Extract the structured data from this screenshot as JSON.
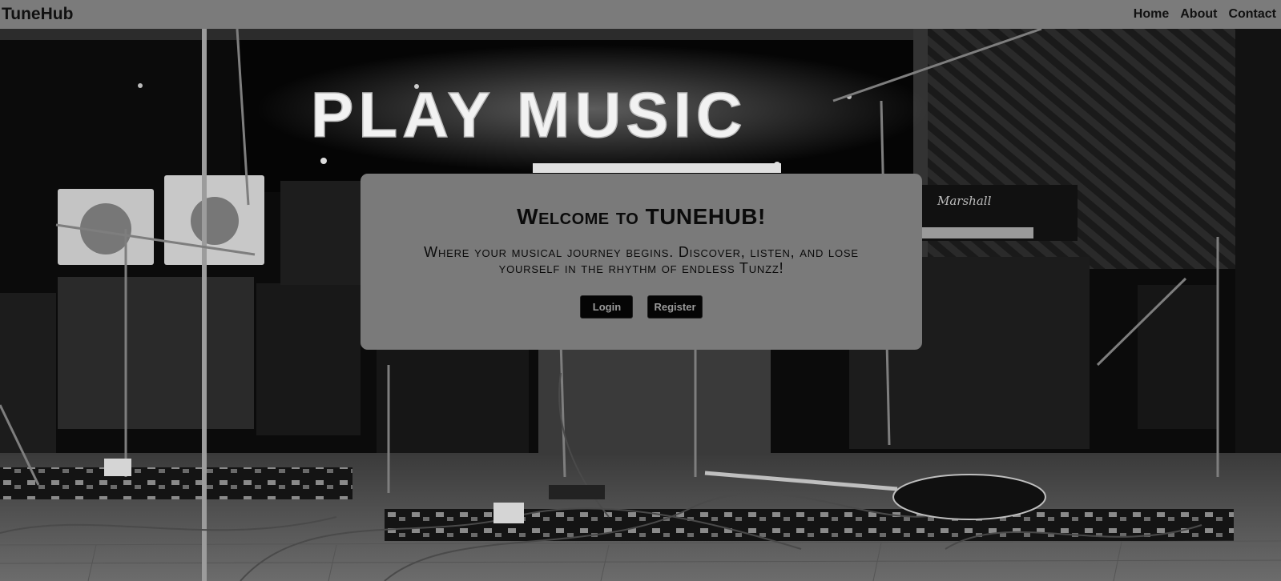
{
  "navbar": {
    "brand": "TuneHub",
    "links": [
      "Home",
      "About",
      "Contact"
    ]
  },
  "hero": {
    "background_text": "PLAY MUSIC",
    "amp_brand": "Marshall"
  },
  "card": {
    "title": "Welcome to TUNEHUB!",
    "subtitle": "Where your musical journey begins. Discover, listen, and lose yourself in the rhythm of endless Tunzz!",
    "login_label": "Login",
    "register_label": "Register"
  },
  "colors": {
    "navbar_bg": "#7b7b7b",
    "card_bg": "#7a7a7a",
    "button_bg": "#050505",
    "button_text": "#9a9a9a"
  }
}
